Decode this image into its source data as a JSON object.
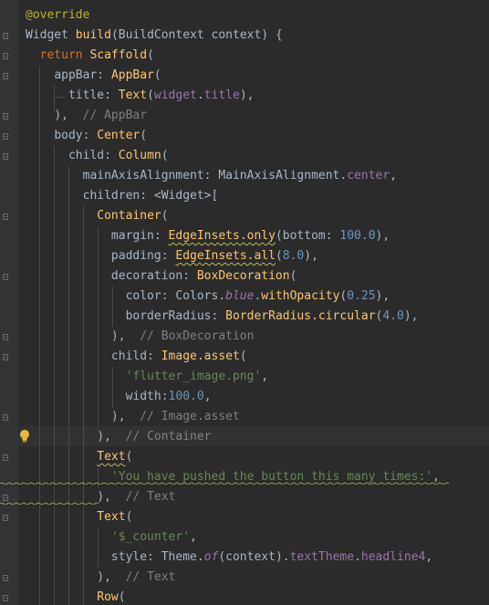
{
  "editor": {
    "theme": "darcula",
    "intention_bulb_icon": "lightbulb-icon",
    "lines": [
      [
        [
          "a",
          "@override"
        ]
      ],
      [
        [
          "t",
          "Widget "
        ],
        [
          "f",
          "build"
        ],
        [
          "t",
          "(BuildContext context) {"
        ]
      ],
      [
        [
          "t",
          "  "
        ],
        [
          "k",
          "return "
        ],
        [
          "f",
          "Scaffold"
        ],
        [
          "t",
          "("
        ]
      ],
      [
        [
          "t",
          "    "
        ],
        [
          "t",
          "appBar: "
        ],
        [
          "f",
          "AppBar"
        ],
        [
          "t",
          "("
        ]
      ],
      [
        [
          "t",
          "      "
        ],
        [
          "t",
          "title: "
        ],
        [
          "f",
          "Text"
        ],
        [
          "t",
          "("
        ],
        [
          "p",
          "widget"
        ],
        [
          "t",
          "."
        ],
        [
          "p",
          "title"
        ],
        [
          "t",
          "),"
        ]
      ],
      [
        [
          "t",
          "    "
        ],
        [
          "t",
          "),  "
        ],
        [
          "c",
          "// AppBar"
        ]
      ],
      [
        [
          "t",
          "    "
        ],
        [
          "t",
          "body: "
        ],
        [
          "f",
          "Center"
        ],
        [
          "t",
          "("
        ]
      ],
      [
        [
          "t",
          "      "
        ],
        [
          "t",
          "child: "
        ],
        [
          "f",
          "Column"
        ],
        [
          "t",
          "("
        ]
      ],
      [
        [
          "t",
          "        "
        ],
        [
          "t",
          "mainAxisAlignment: MainAxisAlignment."
        ],
        [
          "p",
          "center"
        ],
        [
          "t",
          ","
        ]
      ],
      [
        [
          "t",
          "        "
        ],
        [
          "t",
          "children: <Widget>["
        ]
      ],
      [
        [
          "t",
          "          "
        ],
        [
          "f",
          "Container"
        ],
        [
          "t",
          "("
        ]
      ],
      [
        [
          "t",
          "            "
        ],
        [
          "t",
          "margin: "
        ],
        [
          "fsq",
          "EdgeInsets.only"
        ],
        [
          "t",
          "(bottom: "
        ],
        [
          "n",
          "100.0"
        ],
        [
          "t",
          "),"
        ]
      ],
      [
        [
          "t",
          "            "
        ],
        [
          "t",
          "padding: "
        ],
        [
          "fsq",
          "EdgeInsets.all"
        ],
        [
          "t",
          "("
        ],
        [
          "n",
          "8.0"
        ],
        [
          "t",
          "),"
        ]
      ],
      [
        [
          "t",
          "            "
        ],
        [
          "t",
          "decoration: "
        ],
        [
          "f",
          "BoxDecoration"
        ],
        [
          "t",
          "("
        ]
      ],
      [
        [
          "t",
          "              "
        ],
        [
          "t",
          "color: Colors."
        ],
        [
          "i",
          "blue"
        ],
        [
          "t",
          "."
        ],
        [
          "f",
          "withOpacity"
        ],
        [
          "t",
          "("
        ],
        [
          "n",
          "0.25"
        ],
        [
          "t",
          "),"
        ]
      ],
      [
        [
          "t",
          "              "
        ],
        [
          "t",
          "borderRadius: "
        ],
        [
          "f",
          "BorderRadius.circular"
        ],
        [
          "t",
          "("
        ],
        [
          "n",
          "4.0"
        ],
        [
          "t",
          "),"
        ]
      ],
      [
        [
          "t",
          "            "
        ],
        [
          "t",
          "),  "
        ],
        [
          "c",
          "// BoxDecoration"
        ]
      ],
      [
        [
          "t",
          "            "
        ],
        [
          "t",
          "child: "
        ],
        [
          "f",
          "Image.asset"
        ],
        [
          "t",
          "("
        ]
      ],
      [
        [
          "t",
          "              "
        ],
        [
          "s",
          "'flutter_image.png'"
        ],
        [
          "t",
          ","
        ]
      ],
      [
        [
          "t",
          "              "
        ],
        [
          "t",
          "width:"
        ],
        [
          "n",
          "100.0"
        ],
        [
          "t",
          ","
        ]
      ],
      [
        [
          "t",
          "            "
        ],
        [
          "t",
          "),  "
        ],
        [
          "c",
          "// Image.asset"
        ]
      ],
      [
        [
          "t",
          "          "
        ],
        [
          "t",
          "),  "
        ],
        [
          "c",
          "// Container"
        ]
      ],
      [
        [
          "t",
          "          "
        ],
        [
          "fsq",
          "Text"
        ],
        [
          "t",
          "("
        ]
      ],
      [
        [
          "t",
          "            "
        ],
        [
          "s",
          "'You have pushed the button this many times:'"
        ],
        [
          "t",
          ","
        ]
      ],
      [
        [
          "t",
          "          "
        ],
        [
          "t",
          "),  "
        ],
        [
          "c",
          "// Text"
        ]
      ],
      [
        [
          "t",
          "          "
        ],
        [
          "f",
          "Text"
        ],
        [
          "t",
          "("
        ]
      ],
      [
        [
          "t",
          "            "
        ],
        [
          "s",
          "'$_counter'"
        ],
        [
          "t",
          ","
        ]
      ],
      [
        [
          "t",
          "            "
        ],
        [
          "t",
          "style: Theme."
        ],
        [
          "i",
          "of"
        ],
        [
          "t",
          "(context)."
        ],
        [
          "p",
          "textTheme"
        ],
        [
          "t",
          "."
        ],
        [
          "p",
          "headline4"
        ],
        [
          "t",
          ","
        ]
      ],
      [
        [
          "t",
          "          "
        ],
        [
          "t",
          "),  "
        ],
        [
          "c",
          "// Text"
        ]
      ],
      [
        [
          "t",
          "          "
        ],
        [
          "f",
          "Row"
        ],
        [
          "t",
          "("
        ]
      ]
    ]
  }
}
